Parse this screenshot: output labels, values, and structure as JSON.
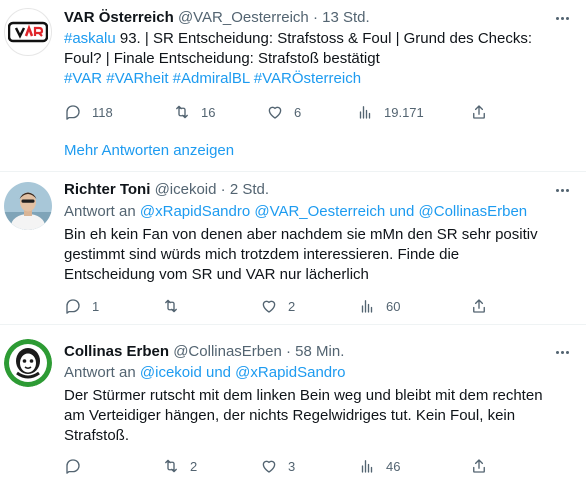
{
  "tweets": [
    {
      "name": "VAR Österreich",
      "handle": "@VAR_Oesterreich",
      "time": "13 Std.",
      "avatar_text": "VAR",
      "lines": [
        {
          "link": "#askalu",
          "text": " 93. | SR Entscheidung: Strafstoss & Foul | Grund des Checks:"
        },
        {
          "text": "Foul? | Finale Entscheidung: Strafstoß bestätigt"
        },
        {
          "link": "#VAR #VARheit #AdmiralBL #VARÖsterreich"
        }
      ],
      "actions": {
        "replies": "118",
        "retweets": "16",
        "likes": "6",
        "views": "19.171"
      }
    },
    {
      "name": "Richter Toni",
      "handle": "@icekoid",
      "time": "2 Std.",
      "reply_prefix": "Antwort an",
      "reply_to": "@xRapidSandro @VAR_Oesterreich und @CollinasErben",
      "lines": [
        {
          "text": "Bin eh kein Fan von denen aber nachdem sie mMn den SR sehr positiv"
        },
        {
          "text": "gestimmt sind würds mich trotzdem interessieren. Finde die"
        },
        {
          "text": "Entscheidung vom SR und VAR nur lächerlich"
        }
      ],
      "actions": {
        "replies": "1",
        "retweets": "",
        "likes": "2",
        "views": "60"
      }
    },
    {
      "name": "Collinas Erben",
      "handle": "@CollinasErben",
      "time": "58 Min.",
      "reply_prefix": "Antwort an",
      "reply_to": "@icekoid und @xRapidSandro",
      "lines": [
        {
          "text": "Der Stürmer rutscht mit dem linken Bein weg und bleibt mit dem rechten"
        },
        {
          "text": "am Verteidiger hängen, der nichts Regelwidriges tut. Kein Foul, kein"
        },
        {
          "text": "Strafstoß."
        }
      ],
      "actions": {
        "replies": "",
        "retweets": "2",
        "likes": "3",
        "views": "46"
      }
    }
  ],
  "more_replies_label": "Mehr Antworten anzeigen",
  "separator": "·",
  "colors": {
    "accent": "#1d9bf0",
    "muted": "#536471",
    "text": "#0f1419",
    "divider": "#eff3f4"
  },
  "icons": [
    "reply-icon",
    "retweet-icon",
    "like-icon",
    "views-icon",
    "share-icon",
    "more-icon"
  ]
}
